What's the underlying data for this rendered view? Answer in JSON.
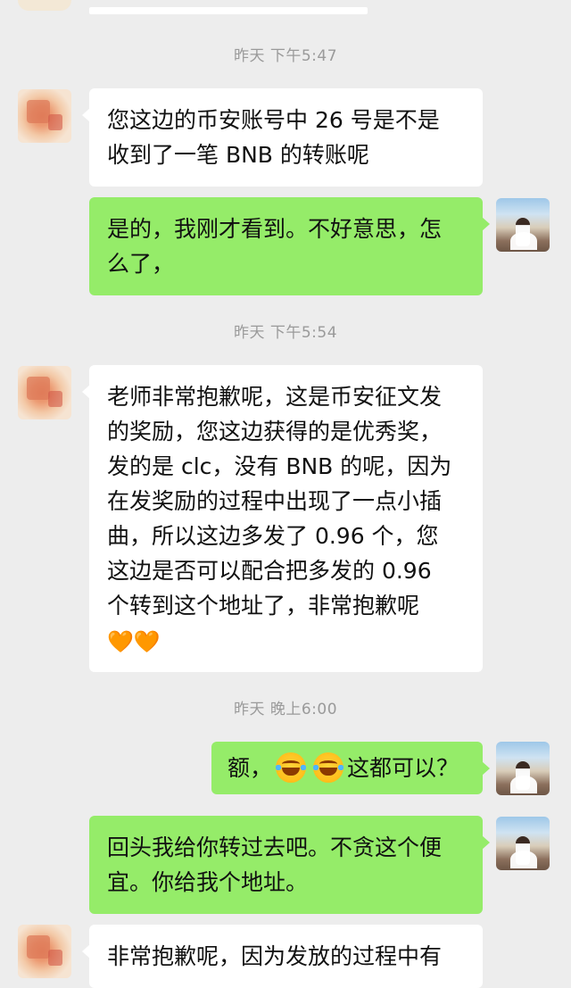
{
  "chat": {
    "timestamps": [
      "昨天 下午5:47",
      "昨天 下午5:54",
      "昨天 晚上6:00"
    ],
    "messages": [
      {
        "sender": "other",
        "lines": [
          "您这边的币安账号中 26 号是不是",
          "收到了一笔 BNB 的转账呢"
        ]
      },
      {
        "sender": "me",
        "lines": [
          "是的，我刚才看到。不好意思，怎",
          "么了，"
        ]
      },
      {
        "sender": "other",
        "lines": [
          "老师非常抱歉呢，这是币安征文发",
          "的奖励，您这边获得的是优秀奖，",
          "发的是 clc，没有 BNB 的呢，因为",
          "在发奖励的过程中出现了一点小插",
          "曲，所以这边多发了 0.96 个，您",
          "这边是否可以配合把多发的 0.96",
          "个转到这个地址了，非常抱歉呢"
        ],
        "emoji_line": "🧡🧡"
      },
      {
        "sender": "me",
        "prefix": "额，",
        "suffix": "这都可以？",
        "emoji_name": "laugh-cry-icon"
      },
      {
        "sender": "me",
        "lines": [
          "回头我给你转过去吧。不贪这个便",
          "宜。你给我个地址。"
        ]
      },
      {
        "sender": "other",
        "lines": [
          "非常抱歉呢，因为发放的过程中有"
        ]
      }
    ]
  },
  "colors": {
    "background": "#ededed",
    "bubble_other": "#ffffff",
    "bubble_me": "#95ec69",
    "timestamp": "#9a9a9a"
  }
}
